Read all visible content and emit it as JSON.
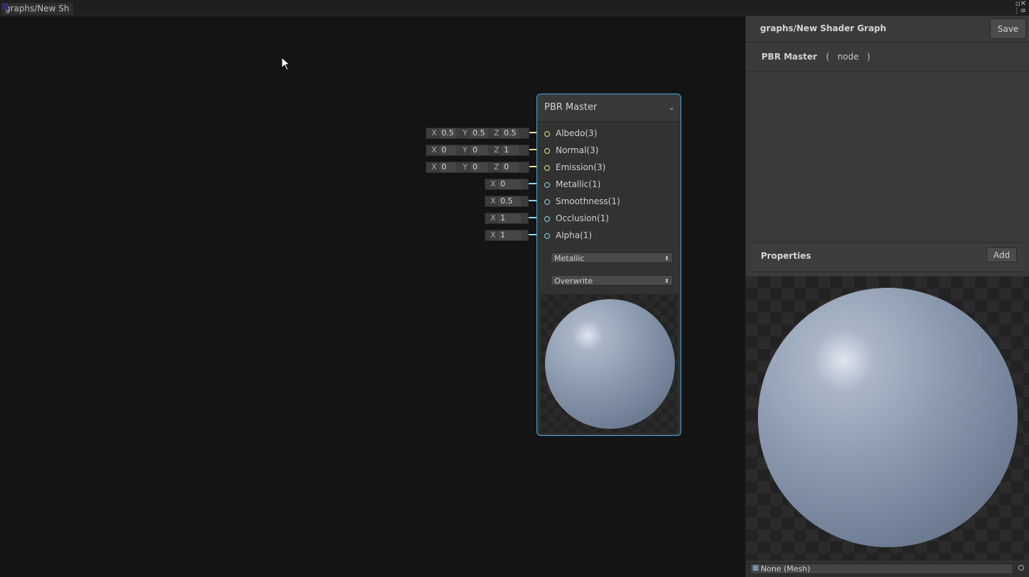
{
  "tab": {
    "title": "graphs/New Sh"
  },
  "window": {
    "icons": "▫✕"
  },
  "node": {
    "title": "PBR Master",
    "chevron": "⌄",
    "ports": [
      {
        "label": "Albedo(3)",
        "color": "#e8e38a",
        "fields": [
          [
            "X",
            "0.5"
          ],
          [
            "Y",
            "0.5"
          ],
          [
            "Z",
            "0.5"
          ]
        ]
      },
      {
        "label": "Normal(3)",
        "color": "#e8e38a",
        "fields": [
          [
            "X",
            "0"
          ],
          [
            "Y",
            "0"
          ],
          [
            "Z",
            "1"
          ]
        ]
      },
      {
        "label": "Emission(3)",
        "color": "#e8e38a",
        "fields": [
          [
            "X",
            "0"
          ],
          [
            "Y",
            "0"
          ],
          [
            "Z",
            "0"
          ]
        ]
      },
      {
        "label": "Metallic(1)",
        "color": "#8cd4f0",
        "fields": [
          [
            "X",
            "0"
          ]
        ]
      },
      {
        "label": "Smoothness(1)",
        "color": "#8cd4f0",
        "fields": [
          [
            "X",
            "0.5"
          ]
        ]
      },
      {
        "label": "Occlusion(1)",
        "color": "#8cd4f0",
        "fields": [
          [
            "X",
            "1"
          ]
        ]
      },
      {
        "label": "Alpha(1)",
        "color": "#8cd4f0",
        "fields": [
          [
            "X",
            "1"
          ]
        ]
      }
    ],
    "workflow": "Metallic",
    "surface": "Overwrite"
  },
  "inspector": {
    "graph_path": "graphs/New Shader Graph",
    "save_label": "Save",
    "master_name": "PBR Master",
    "master_type": "(   node   )",
    "properties_title": "Properties",
    "add_label": "Add",
    "mesh": "None (Mesh)"
  }
}
